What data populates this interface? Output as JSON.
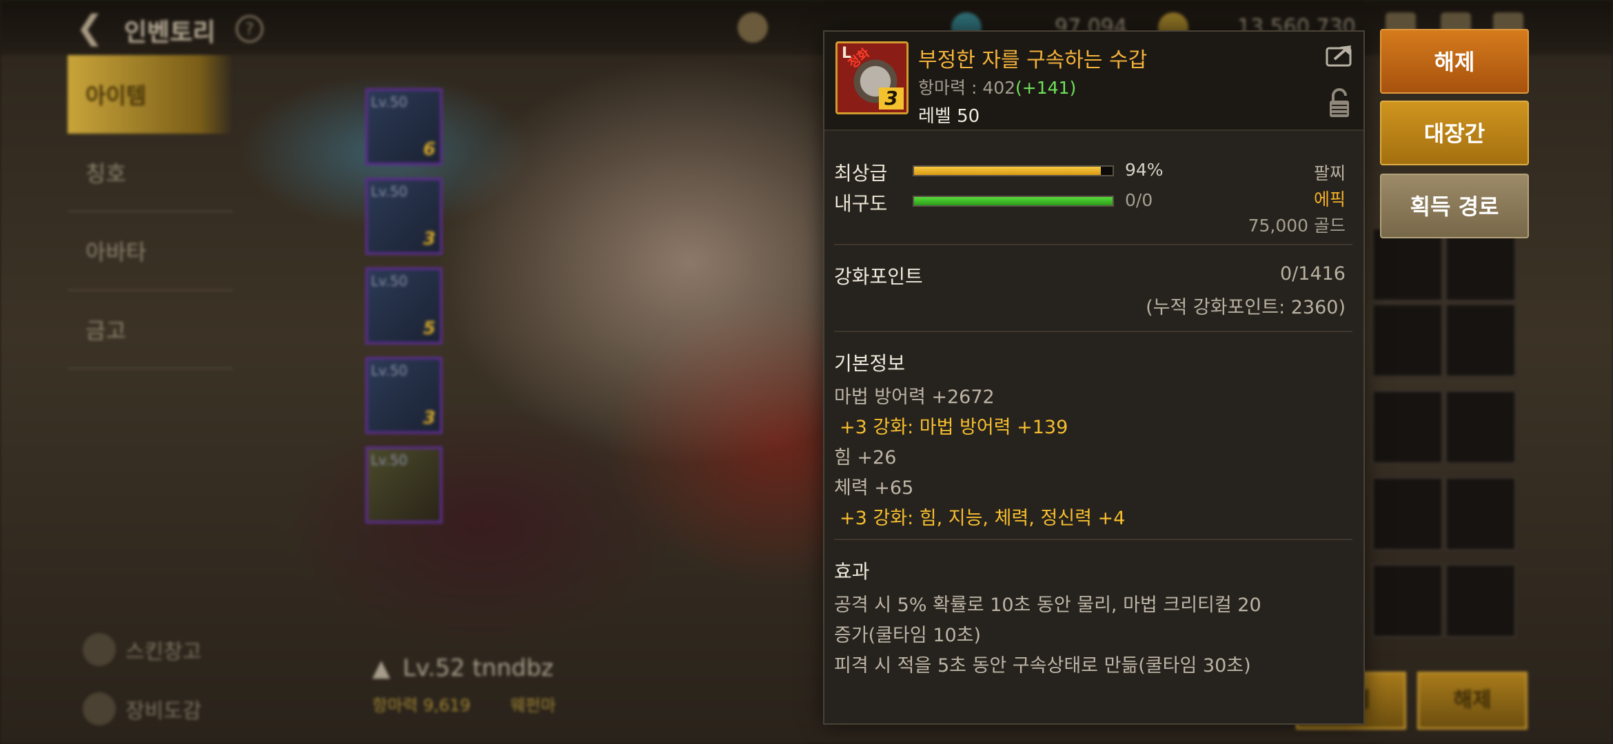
{
  "top_bar": {
    "title": "인벤토리",
    "currencies": [
      "97,094",
      "13,560,730"
    ]
  },
  "tabs": [
    "아이템",
    "칭호",
    "아바타",
    "금고"
  ],
  "bottom_menu": [
    "스킨창고",
    "장비도감"
  ],
  "equipment_slots": [
    {
      "label": "Lv.50",
      "enh": "6"
    },
    {
      "label": "Lv.50",
      "enh": "3"
    },
    {
      "label": "Lv.50",
      "enh": "5"
    },
    {
      "label": "Lv.50",
      "enh": "3"
    },
    {
      "label": "Lv.50",
      "enh": ""
    }
  ],
  "character": {
    "name": "Lv.52 tnndbz",
    "power": "항마력 9,619",
    "job": "웨펀마"
  },
  "bottom_buttons": [
    "해제",
    "해제"
  ],
  "item": {
    "icon_level": "L",
    "icon_tag": "정화",
    "icon_enh": "3",
    "name": "부정한 자를 구속하는 수갑",
    "power_label": "항마력 : 402",
    "power_bonus": "(+141)",
    "level": "레벨 50",
    "grade_label": "최상급",
    "grade_percent": 94,
    "grade_value": "94%",
    "durability_label": "내구도",
    "durability_percent": 100,
    "durability_value": "0/0",
    "slot_type": "팔찌",
    "rarity": "에픽",
    "price": "75,000 골드",
    "enhance_label": "강화포인트",
    "enhance_value": "0/1416",
    "enhance_total": "(누적 강화포인트: 2360)",
    "basic_title": "기본정보",
    "basic_lines": [
      {
        "text": "마법 방어력 +2672",
        "gold": false
      },
      {
        "text": "+3 강화: 마법 방어력 +139",
        "gold": true
      },
      {
        "text": "힘 +26",
        "gold": false
      },
      {
        "text": "체력 +65",
        "gold": false
      },
      {
        "text": "+3 강화: 힘, 지능, 체력, 정신력 +4",
        "gold": true
      }
    ],
    "effect_title": "효과",
    "effect_lines": [
      "공격 시 5% 확률로 10초 동안 물리, 마법 크리티컬 20",
      "증가(쿨타임 10초)",
      "피격 시 적을 5초 동안 구속상태로 만듦(쿨타임 30초)"
    ]
  },
  "actions": {
    "unequip": "해제",
    "forge": "대장간",
    "acquire_route": "획득 경로"
  },
  "colors": {
    "grade_bar": "#f2b425",
    "durability_bar": "#3fbf2a",
    "rarity": "#f5b22a",
    "item_name": "#f6b33a"
  }
}
